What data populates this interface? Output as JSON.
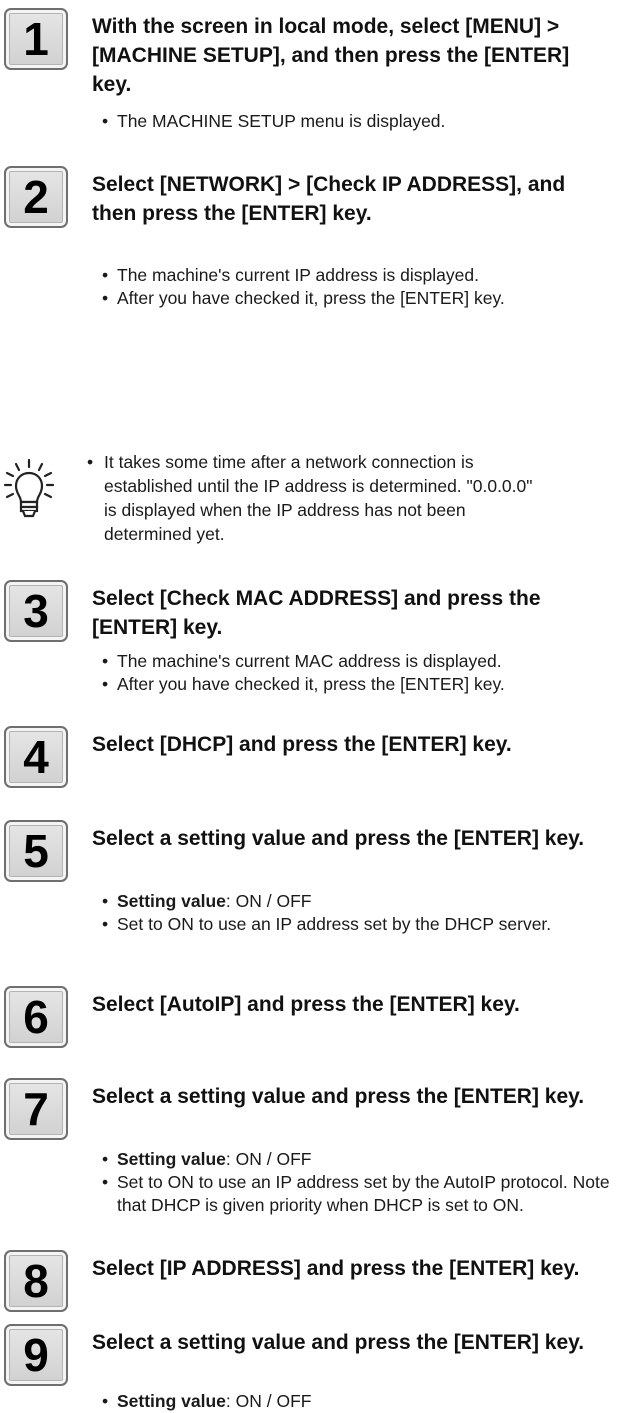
{
  "steps": [
    {
      "number": "1",
      "title": "With the screen in local mode, select [MENU] > [MACHINE SETUP], and then press the [ENTER] key.",
      "bullets": [
        {
          "text": "The MACHINE SETUP menu is displayed."
        }
      ]
    },
    {
      "number": "2",
      "title": "Select [NETWORK] > [Check IP ADDRESS], and then press the [ENTER] key.",
      "bullets": [
        {
          "text": "The machine's current IP address is displayed."
        },
        {
          "text": "After you have checked it, press the [ENTER] key."
        }
      ]
    },
    {
      "number": "3",
      "title": "Select [Check MAC ADDRESS] and press the [ENTER] key.",
      "bullets": [
        {
          "text": "The machine's current MAC address is displayed."
        },
        {
          "text": "After you have checked it, press the [ENTER] key."
        }
      ]
    },
    {
      "number": "4",
      "title": "Select [DHCP] and press the [ENTER] key.",
      "bullets": []
    },
    {
      "number": "5",
      "title": "Select a setting value and press the [ENTER] key.",
      "bullets": [
        {
          "bold": "Setting value",
          "text": ": ON / OFF"
        },
        {
          "text": "Set to ON to use an IP address set by the DHCP server."
        }
      ]
    },
    {
      "number": "6",
      "title": "Select [AutoIP] and press the [ENTER] key.",
      "bullets": []
    },
    {
      "number": "7",
      "title": "Select a setting value and press the [ENTER] key.",
      "bullets": [
        {
          "bold": "Setting value",
          "text": ": ON / OFF"
        },
        {
          "text": "Set to ON to use an IP address set by the AutoIP protocol. Note that DHCP is given priority when DHCP is set to ON."
        }
      ]
    },
    {
      "number": "8",
      "title": "Select [IP ADDRESS] and press the [ENTER] key.",
      "bullets": []
    },
    {
      "number": "9",
      "title": "Select a setting value and press the [ENTER] key.",
      "bullets": [
        {
          "bold": "Setting value",
          "text": ": ON / OFF"
        }
      ]
    }
  ],
  "note": {
    "icon": "lightbulb-icon",
    "text": "It takes some time after a network connection is established until the IP address is determined. \"0.0.0.0\" is displayed when the IP address has not been determined yet."
  }
}
